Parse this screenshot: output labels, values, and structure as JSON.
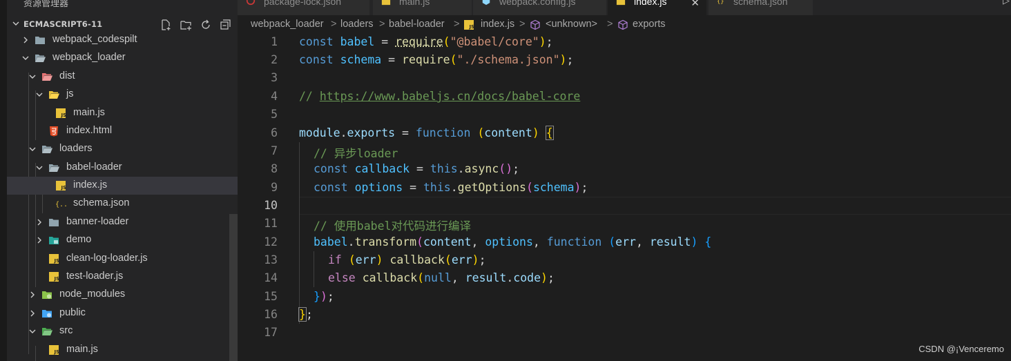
{
  "sidebar": {
    "header_title": "资源管理器",
    "header_more": "···",
    "project_name": "ECMASCRIPT6-11",
    "items": [
      {
        "label": "webpack_codespilt",
        "icon": "folder-icon"
      },
      {
        "label": "webpack_loader",
        "icon": "folder-open-icon"
      },
      {
        "label": "dist",
        "icon": "folder-dist-icon"
      },
      {
        "label": "js",
        "icon": "folder-js-icon"
      },
      {
        "label": "main.js",
        "icon": "js-file-icon"
      },
      {
        "label": "index.html",
        "icon": "html-file-icon"
      },
      {
        "label": "loaders",
        "icon": "folder-open-icon"
      },
      {
        "label": "babel-loader",
        "icon": "folder-open-icon"
      },
      {
        "label": "index.js",
        "icon": "js-file-icon"
      },
      {
        "label": "schema.json",
        "icon": "json-file-icon"
      },
      {
        "label": "banner-loader",
        "icon": "folder-icon"
      },
      {
        "label": "demo",
        "icon": "folder-demo-icon"
      },
      {
        "label": "clean-log-loader.js",
        "icon": "js-file-icon"
      },
      {
        "label": "test-loader.js",
        "icon": "js-file-icon"
      },
      {
        "label": "node_modules",
        "icon": "folder-node-icon"
      },
      {
        "label": "public",
        "icon": "folder-public-icon"
      },
      {
        "label": "src",
        "icon": "folder-src-icon"
      },
      {
        "label": "main.js",
        "icon": "js-file-icon"
      }
    ]
  },
  "tabs": [
    {
      "label": "package-lock.json",
      "icon": "json-file-icon"
    },
    {
      "label": "main.js",
      "icon": "js-file-icon"
    },
    {
      "label": "webpack.config.js",
      "icon": "webpack-icon"
    },
    {
      "label": "index.js",
      "icon": "js-file-icon",
      "active": true
    },
    {
      "label": "schema.json",
      "icon": "json-file-icon"
    }
  ],
  "tab_close": "✕",
  "run_glyph": "▷",
  "breadcrumb": {
    "parts": [
      "webpack_loader",
      "loaders",
      "babel-loader",
      "index.js",
      "<unknown>",
      "exports"
    ],
    "separator": ">"
  },
  "editor": {
    "current_line": 10,
    "line_numbers": [
      "1",
      "2",
      "3",
      "4",
      "5",
      "6",
      "7",
      "8",
      "9",
      "10",
      "11",
      "12",
      "13",
      "14",
      "15",
      "16",
      "17"
    ],
    "tokens": {
      "l1": [
        "const",
        " ",
        "babel",
        " = ",
        "require",
        "(",
        "\"@babel/core\"",
        ")",
        ";"
      ],
      "l2": [
        "const",
        " ",
        "schema",
        " = ",
        "require",
        "(",
        "\"./schema.json\"",
        ")",
        ";"
      ],
      "l4": [
        "// ",
        "https://www.babeljs.cn/docs/babel-core"
      ],
      "l6": [
        "module",
        ".",
        "exports",
        " = ",
        "function",
        " ",
        "(",
        "content",
        ")",
        " ",
        "{"
      ],
      "l7": [
        "// 异步loader"
      ],
      "l8": [
        "const",
        " ",
        "callback",
        " = ",
        "this",
        ".",
        "async",
        "(",
        ")",
        ";"
      ],
      "l9": [
        "const",
        " ",
        "options",
        " = ",
        "this",
        ".",
        "getOptions",
        "(",
        "schema",
        ")",
        ";"
      ],
      "l11": [
        "// 使用babel对代码进行编译"
      ],
      "l12": [
        "babel",
        ".",
        "transform",
        "(",
        "content",
        ", ",
        "options",
        ", ",
        "function",
        " ",
        "(",
        "err",
        ", ",
        "result",
        ")",
        " ",
        "{"
      ],
      "l13": [
        "if",
        " ",
        "(",
        "err",
        ")",
        " ",
        "callback",
        "(",
        "err",
        ")",
        ";"
      ],
      "l14": [
        "else",
        " ",
        "callback",
        "(",
        "null",
        ", ",
        "result",
        ".",
        "code",
        ")",
        ";"
      ],
      "l15": [
        "}",
        ")",
        ";"
      ],
      "l16": [
        "}",
        ";"
      ]
    }
  },
  "colors": {
    "background": "#1e1e1e",
    "sidebar": "#252526",
    "keyword": "#569cd6",
    "variable": "#9cdcfe",
    "function": "#dcdcaa",
    "string": "#ce9178",
    "comment": "#6a9955",
    "control": "#c586c0",
    "js_icon": "#e8c23a"
  },
  "watermark": "CSDN @¡Venceremo"
}
